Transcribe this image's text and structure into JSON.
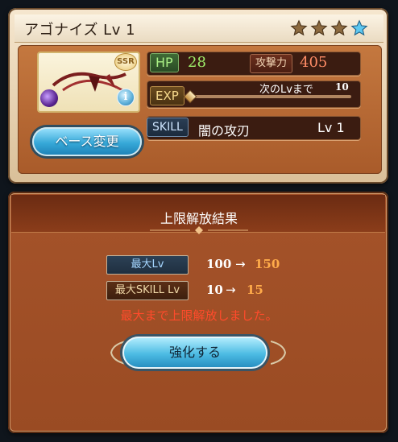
{
  "weapon": {
    "title": "アゴナイズ Lv 1",
    "rarity_badge": "SSR",
    "element_icon": "dark-element-icon",
    "stars": [
      {
        "state": "filled-bronze",
        "icon": "star-icon"
      },
      {
        "state": "filled-bronze",
        "icon": "star-icon"
      },
      {
        "state": "filled-bronze",
        "icon": "star-icon"
      },
      {
        "state": "filled-blue",
        "icon": "star-icon"
      }
    ],
    "base_change_label": "ベース変更",
    "info_label": "i"
  },
  "stats": {
    "hp_label": "HP",
    "hp_value": "28",
    "atk_label": "攻撃力",
    "atk_value": "405",
    "exp_label": "EXP",
    "exp_next_label": "次のLvまで",
    "exp_next_value": "10",
    "skill_label": "SKILL",
    "skill_name": "闇の攻刃",
    "skill_level": "Lv 1"
  },
  "result": {
    "title": "上限解放結果",
    "rows": [
      {
        "label": "最大Lv",
        "from": "100",
        "arrow": "→",
        "to": "150"
      },
      {
        "label": "最大SKILL Lv",
        "from": "10",
        "arrow": "→",
        "to": "15"
      }
    ],
    "message": "最大まで上限解放しました。",
    "enhance_label": "強化する"
  },
  "colors": {
    "accent_blue": "#36a8d8",
    "panel_brown": "#a5532a",
    "highlight_orange": "#ffab4a",
    "message_red": "#ff4b2b"
  }
}
